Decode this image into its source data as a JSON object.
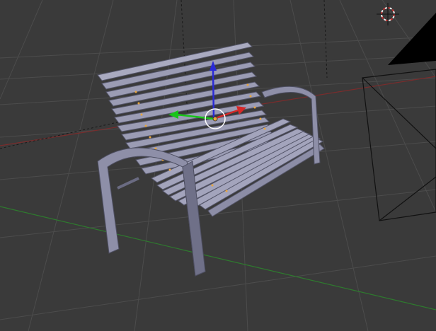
{
  "viewport": {
    "view": "perspective",
    "background_color": "#3a3a3a",
    "grid_color": "#4a4a4a",
    "x_axis_color": "#8a2a2a",
    "y_axis_color": "#2f8a2f"
  },
  "scene": {
    "object": "park-bench",
    "object_color": "#8e8fa8",
    "object_shade_color": "#6a6b82",
    "selected": true
  },
  "gizmo": {
    "x_arrow_color": "#d62828",
    "y_arrow_color": "#19c419",
    "z_arrow_color": "#2a2ad6",
    "origin_color": "#e8a640"
  },
  "icons": {
    "cursor": "3d-cursor-icon",
    "camera": "camera-icon",
    "lamp": "lamp-icon"
  }
}
